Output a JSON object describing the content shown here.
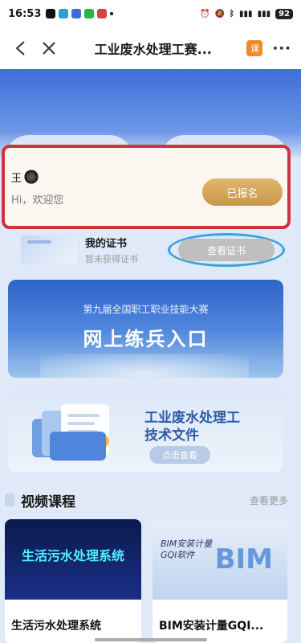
{
  "status_bar": {
    "time": "16:53",
    "battery": "92"
  },
  "nav": {
    "title": "工业废水处理工赛...",
    "app_badge": "课",
    "more": "···"
  },
  "welcome": {
    "name": "王",
    "greeting": "Hi，欢迎您",
    "register_label": "已报名"
  },
  "certificate": {
    "title": "我的证书",
    "subtitle": "暂未获得证书",
    "view_label": "查看证书"
  },
  "practice_banner": {
    "subtitle": "第九届全国职工职业技能大赛",
    "title": "网上练兵入口"
  },
  "doc_card": {
    "line1": "工业废水处理工",
    "line2": "技术文件",
    "button": "点击查看"
  },
  "video_section": {
    "title": "视频课程",
    "more": "查看更多"
  },
  "courses": [
    {
      "thumb_text": "生活污水处理系统",
      "label": "生活污水处理系统"
    },
    {
      "thumb_line1": "BIM安装计量",
      "thumb_line2": "GQI软件",
      "thumb_logo": "BIM",
      "label": "BIM安装计量GQI..."
    }
  ],
  "colors": {
    "accent_red_outline": "#d0333c",
    "accent_blue_outline": "#37a5dc",
    "register_gold": "#c7964a"
  }
}
